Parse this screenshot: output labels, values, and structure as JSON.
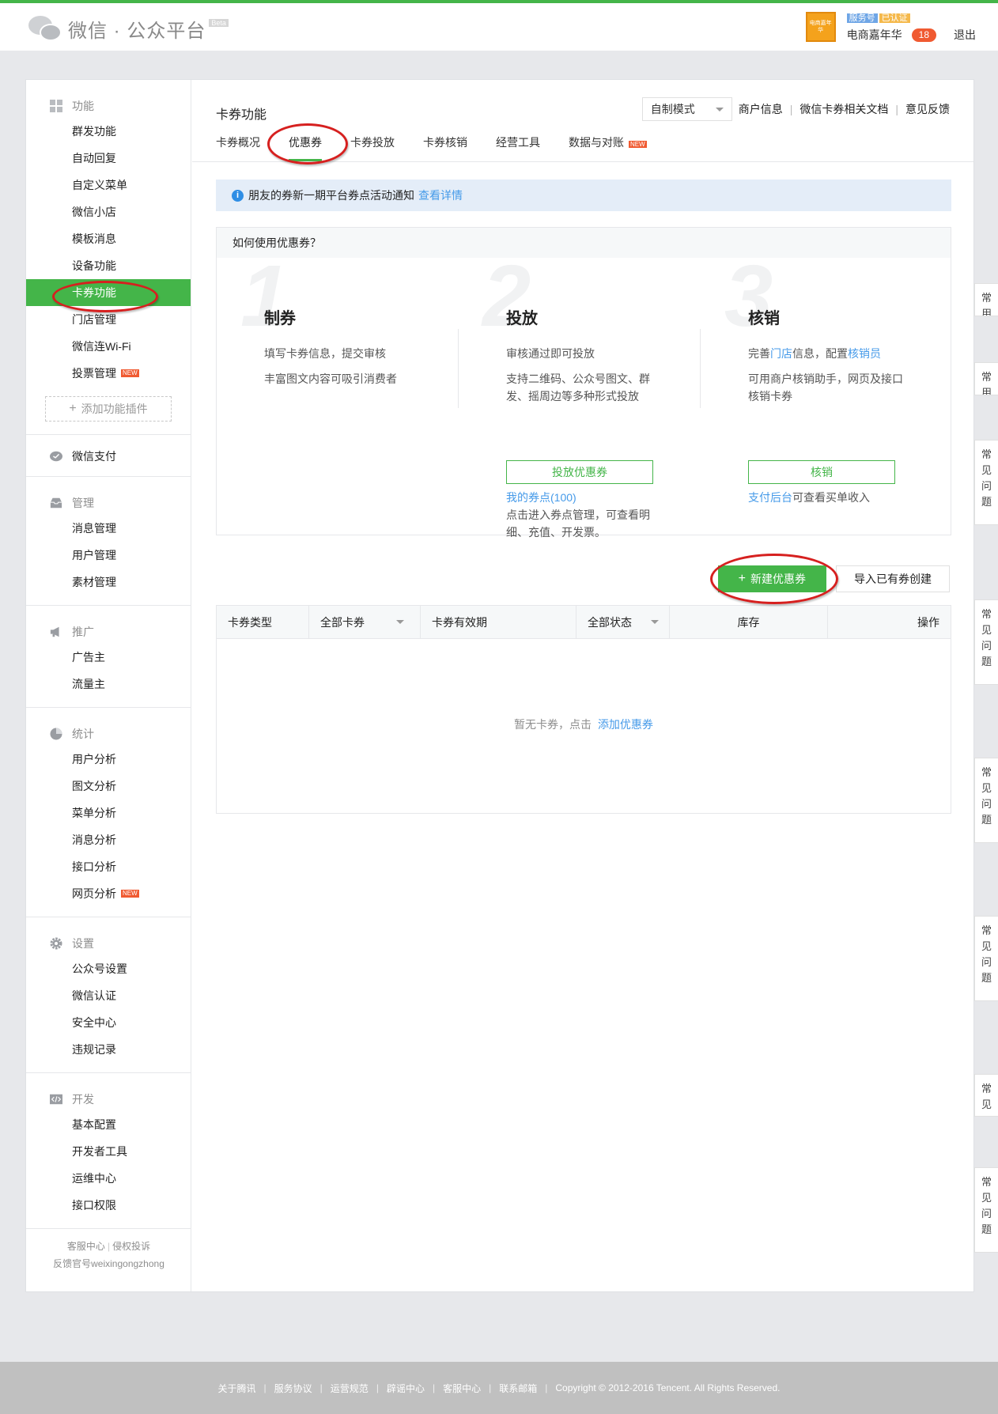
{
  "header": {
    "logo_text": "微信 · 公众平台",
    "beta": "Beta",
    "avatar_text": "电商嘉年华",
    "tag_service": "服务号",
    "tag_verified": "已认证",
    "account_name": "电商嘉年华",
    "notification_count": "18",
    "logout": "退出"
  },
  "sidebar": {
    "groups": [
      {
        "title": "功能",
        "icon": "grid-icon",
        "items": [
          "群发功能",
          "自动回复",
          "自定义菜单",
          "微信小店",
          "模板消息",
          "设备功能",
          "卡券功能",
          "门店管理",
          "微信连Wi-Fi",
          "投票管理"
        ]
      },
      {
        "title": "微信支付",
        "icon": "wallet-icon"
      },
      {
        "title": "管理",
        "icon": "inbox-icon",
        "items": [
          "消息管理",
          "用户管理",
          "素材管理"
        ]
      },
      {
        "title": "推广",
        "icon": "megaphone-icon",
        "items": [
          "广告主",
          "流量主"
        ]
      },
      {
        "title": "统计",
        "icon": "pie-chart-icon",
        "items": [
          "用户分析",
          "图文分析",
          "菜单分析",
          "消息分析",
          "接口分析",
          "网页分析"
        ]
      },
      {
        "title": "设置",
        "icon": "gear-icon",
        "items": [
          "公众号设置",
          "微信认证",
          "安全中心",
          "违规记录"
        ]
      },
      {
        "title": "开发",
        "icon": "code-icon",
        "items": [
          "基本配置",
          "开发者工具",
          "运维中心",
          "接口权限"
        ]
      }
    ],
    "active_item": "卡券功能",
    "new_badge": "NEW",
    "add_plugin": "添加功能插件",
    "footer": {
      "service": "客服中心",
      "infringement": "侵权投诉",
      "feedback_account": "反馈官号weixingongzhong"
    }
  },
  "page": {
    "title": "卡券功能",
    "mode_select": "自制模式",
    "links": [
      "商户信息",
      "微信卡券相关文档",
      "意见反馈"
    ],
    "tabs": [
      "卡券概况",
      "优惠券",
      "卡券投放",
      "卡券核销",
      "经营工具",
      "数据与对账"
    ],
    "active_tab": "优惠券",
    "notice_text": "朋友的券新一期平台券点活动通知",
    "notice_link": "查看详情"
  },
  "howto": {
    "heading": "如何使用优惠券？",
    "steps": [
      {
        "num": "1",
        "title": "制券",
        "lines": [
          "填写卡券信息，提交审核",
          "丰富图文内容可吸引消费者"
        ]
      },
      {
        "num": "2",
        "title": "投放",
        "lines": [
          "审核通过即可投放",
          "支持二维码、公众号图文、群发、摇周边等多种形式投放"
        ],
        "button": "投放优惠券",
        "extra_link": "我的券点(100)",
        "extra_text": "点击进入券点管理，可查看明细、充值、开发票。"
      },
      {
        "num": "3",
        "title": "核销",
        "line1_prefix": "完善",
        "line1_link1": "门店",
        "line1_mid": "信息，配置",
        "line1_link2": "核销员",
        "line2": "可用商户核销助手，网页及接口核销卡券",
        "button": "核销",
        "extra_link": "支付后台",
        "extra_text": "可查看买单收入"
      }
    ]
  },
  "actions": {
    "create": "新建优惠券",
    "import": "导入已有券创建"
  },
  "table": {
    "columns": [
      "卡券类型",
      "全部卡券",
      "卡券有效期",
      "全部状态",
      "库存",
      "操作"
    ],
    "empty_text": "暂无卡券，点击",
    "empty_link": "添加优惠券"
  },
  "float_tabs": [
    "常用",
    "常用",
    "常见问题",
    "常见问题",
    "常见问题",
    "常见问题",
    "常见",
    "常见问题"
  ],
  "footer": {
    "links": [
      "关于腾讯",
      "服务协议",
      "运营规范",
      "辟谣中心",
      "客服中心",
      "联系邮箱"
    ],
    "copyright": "Copyright © 2012-2016 Tencent. All Rights Reserved."
  },
  "colors": {
    "accent": "#44b549",
    "link": "#459ae9",
    "badge": "#f05a31",
    "annotation": "#d6201f"
  }
}
